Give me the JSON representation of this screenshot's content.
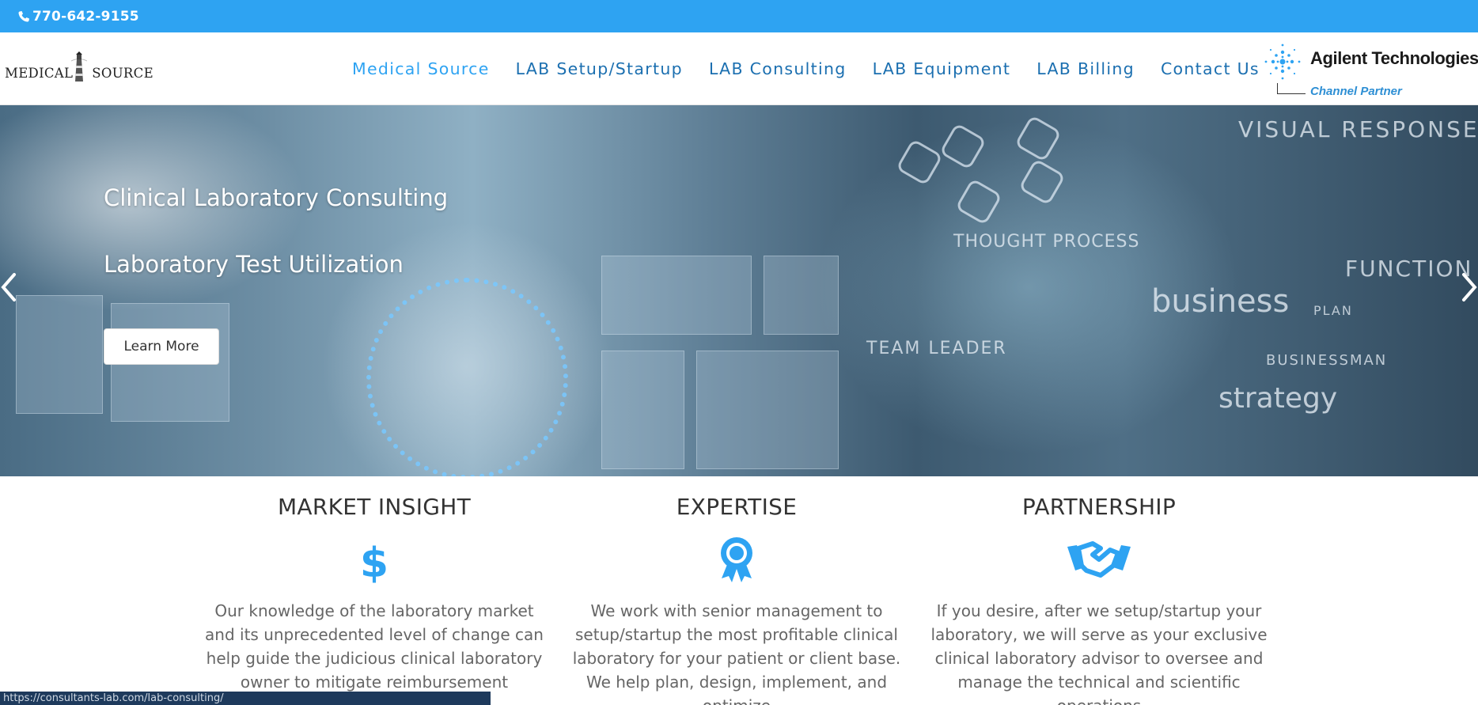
{
  "topbar": {
    "phone": "770-642-9155"
  },
  "header": {
    "logo": {
      "left": "MEDICAL",
      "right": "SOURCE"
    },
    "nav": [
      {
        "label": "Medical Source",
        "active": true
      },
      {
        "label": "LAB Setup/Startup",
        "active": false
      },
      {
        "label": "LAB Consulting",
        "active": false
      },
      {
        "label": "LAB Equipment",
        "active": false
      },
      {
        "label": "LAB Billing",
        "active": false
      },
      {
        "label": "Contact Us",
        "active": false
      }
    ],
    "partner": {
      "name": "Agilent Technologies",
      "tag": "Channel Partner"
    }
  },
  "hero": {
    "title1": "Clinical Laboratory Consulting",
    "title2": "Laboratory Test Utilization",
    "button": "Learn More",
    "watermarks": [
      "VISUAL RESPONSE",
      "THOUGHT PROCESS",
      "business",
      "TEAM LEADER",
      "FUNCTION",
      "PLAN",
      "BUSINESSMAN",
      "strategy"
    ]
  },
  "features": [
    {
      "title": "MARKET INSIGHT",
      "icon": "dollar-icon",
      "text": "Our knowledge of the laboratory market and its unprecedented level of change can help guide the judicious clinical laboratory owner to mitigate reimbursement challenges, pursue"
    },
    {
      "title": "EXPERTISE",
      "icon": "award-ribbon-icon",
      "text": "We work with senior management to setup/startup the most profitable clinical laboratory for your patient or client base. We help plan, design, implement, and optimize"
    },
    {
      "title": "PARTNERSHIP",
      "icon": "handshake-icon",
      "text": "If you desire, after we setup/startup your laboratory, we will serve as your exclusive clinical laboratory advisor to oversee and manage the technical and scientific operations"
    }
  ],
  "status": {
    "url": "https://consultants-lab.com/lab-consulting/"
  },
  "colors": {
    "accent": "#2ea3f2",
    "nav": "#1b6fb0",
    "statusbar": "#1e3a5c"
  }
}
